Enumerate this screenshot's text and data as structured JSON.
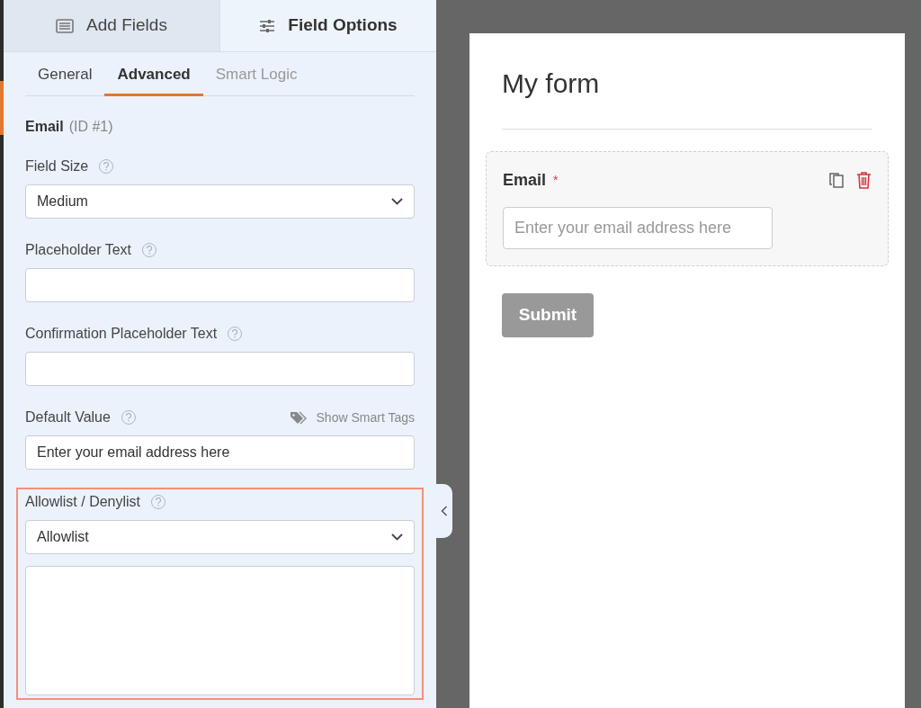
{
  "panel_tabs": [
    {
      "label": "Add Fields",
      "selected": false
    },
    {
      "label": "Field Options",
      "selected": true
    }
  ],
  "sub_tabs": [
    {
      "label": "General",
      "selected": false
    },
    {
      "label": "Advanced",
      "selected": true
    },
    {
      "label": "Smart Logic",
      "selected": false
    }
  ],
  "field_heading": {
    "name": "Email",
    "id": "(ID #1)"
  },
  "options": [
    {
      "kind": "select",
      "label": "Field Size",
      "value": "Medium",
      "highlighted": false
    },
    {
      "kind": "input",
      "label": "Placeholder Text",
      "highlighted": false
    },
    {
      "kind": "input",
      "label": "Confirmation Placeholder Text",
      "highlighted": false
    },
    {
      "kind": "input",
      "label": "Default Value",
      "value": "Enter your email address here",
      "link": "Show Smart Tags",
      "highlighted": false
    },
    {
      "kind": "select_textarea",
      "label": "Allowlist / Denylist",
      "value": "Allowlist",
      "highlighted": true
    }
  ],
  "preview": {
    "title": "My form",
    "field": {
      "label": "Email",
      "required_mark": "*",
      "placeholder": "Enter your email address here"
    },
    "submit": "Submit"
  }
}
